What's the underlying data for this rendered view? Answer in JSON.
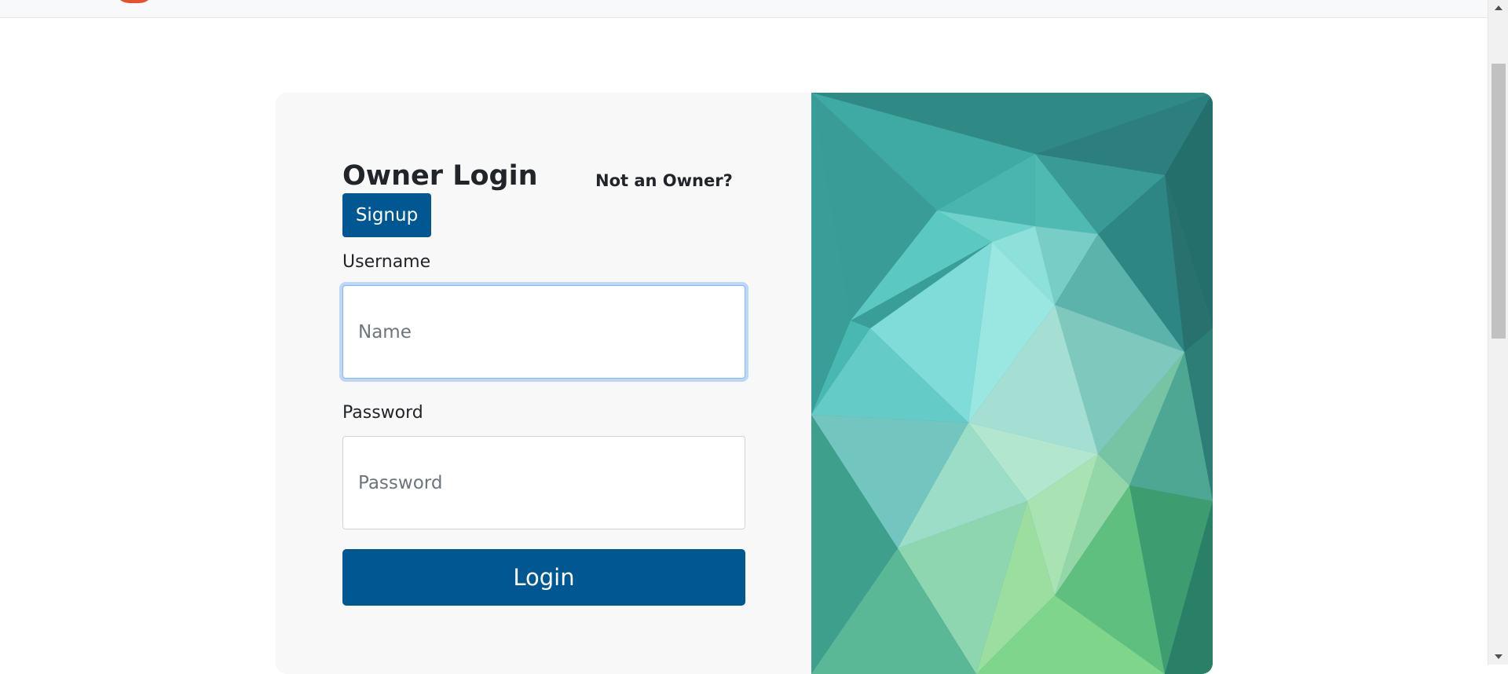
{
  "header": {
    "logo_icon": "brand-logo-icon",
    "brand_color": "#e8502f"
  },
  "login": {
    "title": "Owner Login",
    "not_owner_text": "Not an Owner?",
    "signup_label": "Signup",
    "username_label": "Username",
    "username_placeholder": "Name",
    "username_value": "",
    "password_label": "Password",
    "password_placeholder": "Password",
    "password_value": "",
    "login_label": "Login"
  },
  "theme": {
    "primary": "#005792",
    "card_background": "#f8f8f8",
    "focus_ring": "#86b7fe",
    "decor_palette": [
      "#2e8f8a",
      "#45b3ae",
      "#7fdcd8",
      "#a8e6cf",
      "#6fcf8a",
      "#2f7d6e"
    ]
  },
  "decor": {
    "image_icon": "polygon-art-image"
  }
}
